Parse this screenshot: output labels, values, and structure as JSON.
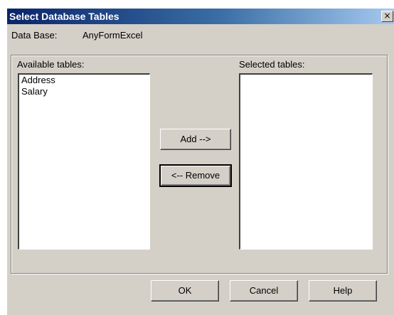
{
  "window": {
    "title": "Select Database Tables",
    "close_glyph": "×"
  },
  "database": {
    "label": "Data Base:",
    "value": "AnyFormExcel"
  },
  "available": {
    "label": "Available tables:",
    "items": [
      "Address",
      "Salary"
    ]
  },
  "selected": {
    "label": "Selected tables:",
    "items": []
  },
  "buttons": {
    "add": "Add -->",
    "remove": "<-- Remove",
    "ok": "OK",
    "cancel": "Cancel",
    "help": "Help"
  },
  "colors": {
    "dialog_bg": "#d4d0c8",
    "title_gradient_start": "#0a246a",
    "title_gradient_end": "#a6caf0"
  }
}
